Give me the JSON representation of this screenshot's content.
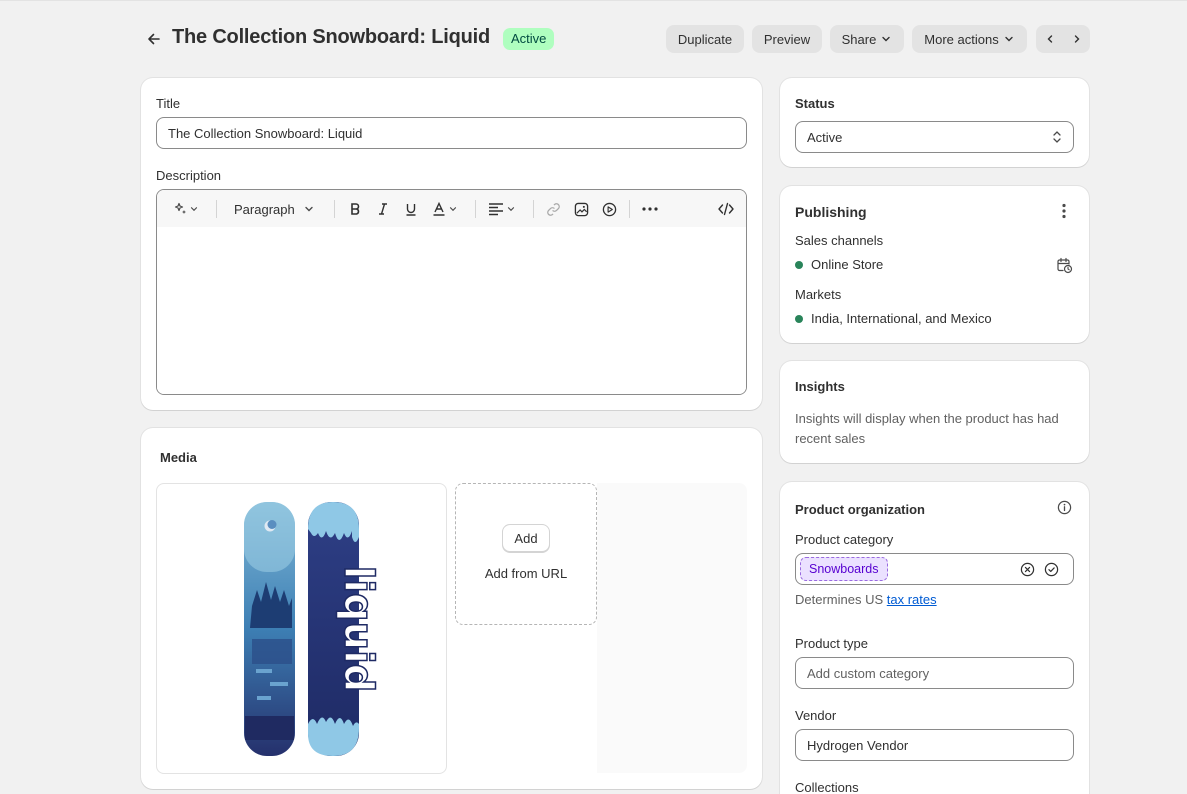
{
  "header": {
    "title": "The Collection Snowboard: Liquid",
    "status_badge": "Active",
    "buttons": {
      "duplicate": "Duplicate",
      "preview": "Preview",
      "share": "Share",
      "more_actions": "More actions"
    }
  },
  "product": {
    "title_label": "Title",
    "title_value": "The Collection Snowboard: Liquid",
    "description_label": "Description",
    "editor": {
      "paragraph_select": "Paragraph"
    }
  },
  "media": {
    "heading": "Media",
    "add_button": "Add",
    "add_from_url": "Add from URL",
    "board_text": "liquid"
  },
  "status_card": {
    "heading": "Status",
    "value": "Active"
  },
  "publishing": {
    "heading": "Publishing",
    "sales_channels_label": "Sales channels",
    "sales_channel": "Online Store",
    "markets_label": "Markets",
    "markets_value": "India, International, and Mexico"
  },
  "insights": {
    "heading": "Insights",
    "text": "Insights will display when the product has had recent sales"
  },
  "organization": {
    "heading": "Product organization",
    "category_label": "Product category",
    "category_tag": "Snowboards",
    "tax_prefix": "Determines US",
    "tax_link": "tax rates",
    "type_label": "Product type",
    "type_placeholder": "Add custom category",
    "vendor_label": "Vendor",
    "vendor_value": "Hydrogen Vendor",
    "collections_label": "Collections"
  },
  "colors": {
    "badge_bg": "#affebf",
    "badge_text": "#014b40",
    "channel_dot": "#29845a",
    "tag_bg": "#ebe1ff",
    "tag_text": "#5700d1",
    "link": "#005bd3"
  }
}
